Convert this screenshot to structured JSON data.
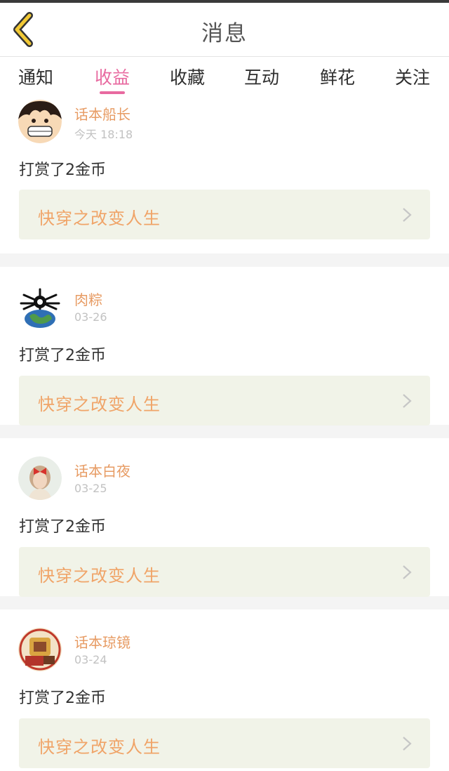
{
  "header": {
    "title": "消息"
  },
  "tabs": [
    {
      "label": "通知",
      "active": false
    },
    {
      "label": "收益",
      "active": true
    },
    {
      "label": "收藏",
      "active": false
    },
    {
      "label": "互动",
      "active": false
    },
    {
      "label": "鲜花",
      "active": false
    },
    {
      "label": "关注",
      "active": false
    }
  ],
  "colors": {
    "accent": "#e86aa0",
    "username": "#e79b63",
    "book_title": "#f0a468",
    "book_bg": "#f1f3e8",
    "back_icon": "#f2c935"
  },
  "feed": [
    {
      "username": "话本船长",
      "time": "今天 18:18",
      "content": "打赏了2金币",
      "book": "快穿之改变人生",
      "avatar_icon": "cartoon-pirate-avatar"
    },
    {
      "username": "肉粽",
      "time": "03-26",
      "content": "打赏了2金币",
      "book": "快穿之改变人生",
      "avatar_icon": "globe-avatar"
    },
    {
      "username": "话本白夜",
      "time": "03-25",
      "content": "打赏了2金币",
      "book": "快穿之改变人生",
      "avatar_icon": "girl-with-bow-avatar"
    },
    {
      "username": "话本琼镜",
      "time": "03-24",
      "content": "打赏了2金币",
      "book": "快穿之改变人生",
      "avatar_icon": "cartoon-avatar"
    }
  ]
}
